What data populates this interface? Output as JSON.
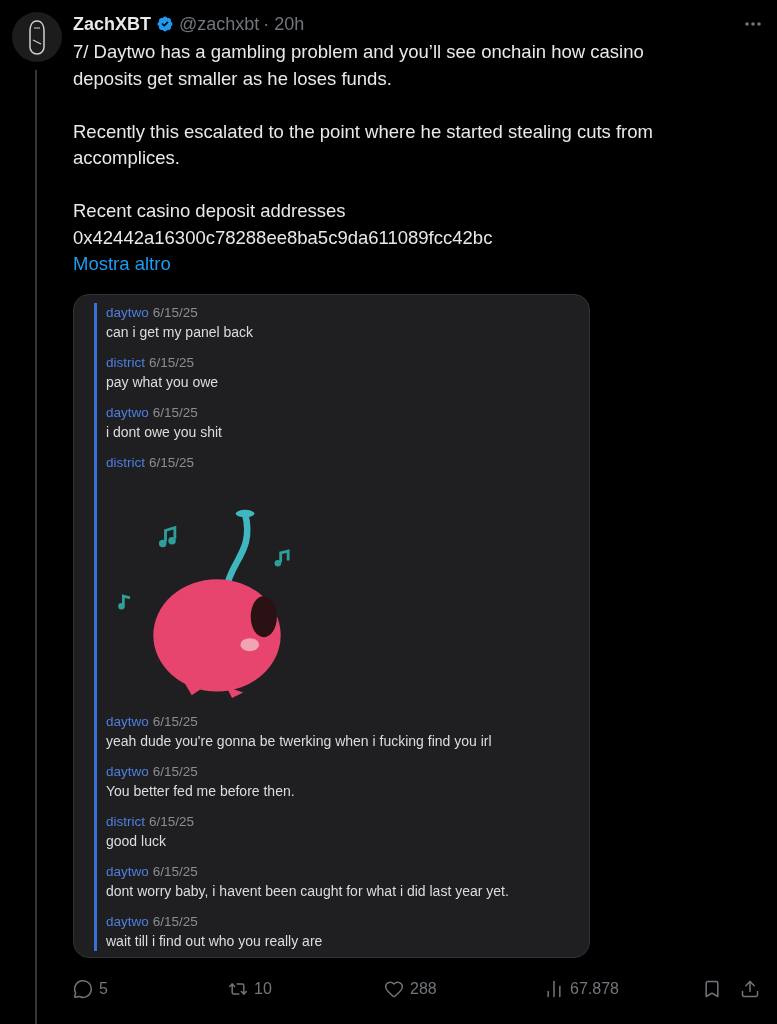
{
  "tweet": {
    "author": "ZachXBT",
    "verified": true,
    "handle": "@zachxbt",
    "time": "· 20h",
    "paragraphs": [
      "7/ Daytwo has a gambling problem and you’ll see onchain how casino deposits get smaller as he loses funds.",
      "Recently this escalated to the point where he started stealing cuts from accomplices.",
      "Recent casino deposit addresses\n0x42442a16300c78288ee8ba5c9da611089fcc42bc"
    ],
    "show_more": "Mostra altro"
  },
  "chat": [
    {
      "kind": "text",
      "author": "daytwo",
      "date": "6/15/25",
      "text": "can i get my panel back"
    },
    {
      "kind": "text",
      "author": "district",
      "date": "6/15/25",
      "text": "pay what you owe"
    },
    {
      "kind": "text",
      "author": "daytwo",
      "date": "6/15/25",
      "text": "i dont owe you shit"
    },
    {
      "kind": "sticker",
      "author": "district",
      "date": "6/15/25"
    },
    {
      "kind": "text",
      "author": "daytwo",
      "date": "6/15/25",
      "text": "yeah dude you're gonna be twerking when i fucking find you irl"
    },
    {
      "kind": "text",
      "author": "daytwo",
      "date": "6/15/25",
      "text": "You better fed me before then."
    },
    {
      "kind": "text",
      "author": "district",
      "date": "6/15/25",
      "text": "good luck"
    },
    {
      "kind": "text",
      "author": "daytwo",
      "date": "6/15/25",
      "text": "dont worry baby, i havent been caught for what i did last year yet."
    },
    {
      "kind": "text",
      "author": "daytwo",
      "date": "6/15/25",
      "text": "wait till i find out who you really are"
    }
  ],
  "actions": [
    {
      "kind": "reply",
      "count": "5"
    },
    {
      "kind": "repost",
      "count": "10"
    },
    {
      "kind": "like",
      "count": "288"
    },
    {
      "kind": "views",
      "count": "67.878"
    },
    {
      "kind": "bookmark"
    },
    {
      "kind": "share"
    }
  ]
}
